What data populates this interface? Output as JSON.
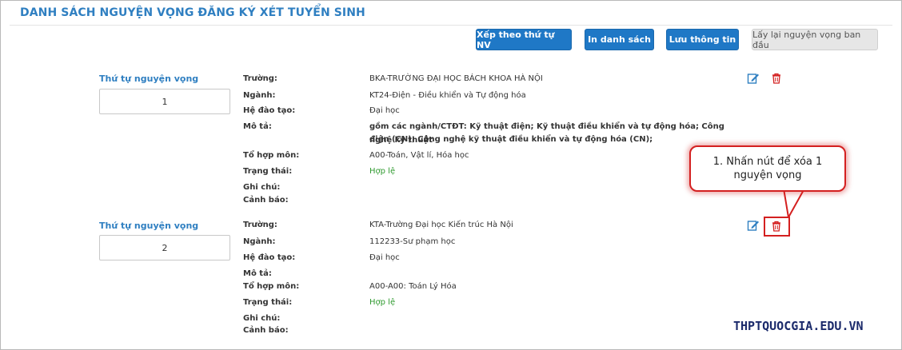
{
  "page_title": "DANH SÁCH NGUYỆN VỌNG ĐĂNG KÝ XÉT TUYỂN SINH",
  "toolbar": {
    "sort_label": "Xếp theo thứ tự NV",
    "print_label": "In danh sách",
    "save_label": "Lưu thông tin",
    "restore_label": "Lấy lại nguyện vọng ban đầu"
  },
  "labels": {
    "order": "Thứ tự nguyện vọng",
    "school": "Trường:",
    "major": "Ngành:",
    "training": "Hệ đào tạo:",
    "description": "Mô tả:",
    "subjects": "Tổ hợp môn:",
    "status": "Trạng thái:",
    "note": "Ghi chú:",
    "warning": "Cảnh báo:"
  },
  "items": [
    {
      "order": "1",
      "school": "BKA-TRƯỜNG ĐẠI HỌC BÁCH KHOA HÀ NỘI",
      "major": "KT24-Điện - Điều khiển và Tự động hóa",
      "training": "Đại học",
      "description_line1": "gồm các ngành/CTĐT: Kỹ thuật điện; Kỹ thuật điều khiển và tự động hóa; Công nghệ kỹ thuật",
      "description_line2": "điện (CN); Công nghệ kỹ thuật điều khiển và tự động hóa (CN);",
      "subjects": "A00-Toán, Vật lí, Hóa học",
      "status": "Hợp lệ",
      "note": "",
      "warning": ""
    },
    {
      "order": "2",
      "school": "KTA-Trường Đại học Kiến trúc Hà Nội",
      "major": "112233-Sư phạm học",
      "training": "Đại học",
      "description_line1": "",
      "description_line2": "",
      "subjects": "A00-A00: Toán Lý Hóa",
      "status": "Hợp lệ",
      "note": "",
      "warning": ""
    }
  ],
  "callout": {
    "line1": "1. Nhấn nút để xóa 1",
    "line2": "nguyện vọng"
  },
  "watermark": "THPTQUOCGIA.EDU.VN",
  "colors": {
    "title": "#2f7fc1",
    "primary_button": "#1f78c6",
    "valid_status": "#2f9a2f",
    "delete_icon": "#d42020",
    "edit_icon": "#2f7fc1"
  },
  "icons": {
    "edit": "edit-icon",
    "delete": "trash-icon"
  }
}
